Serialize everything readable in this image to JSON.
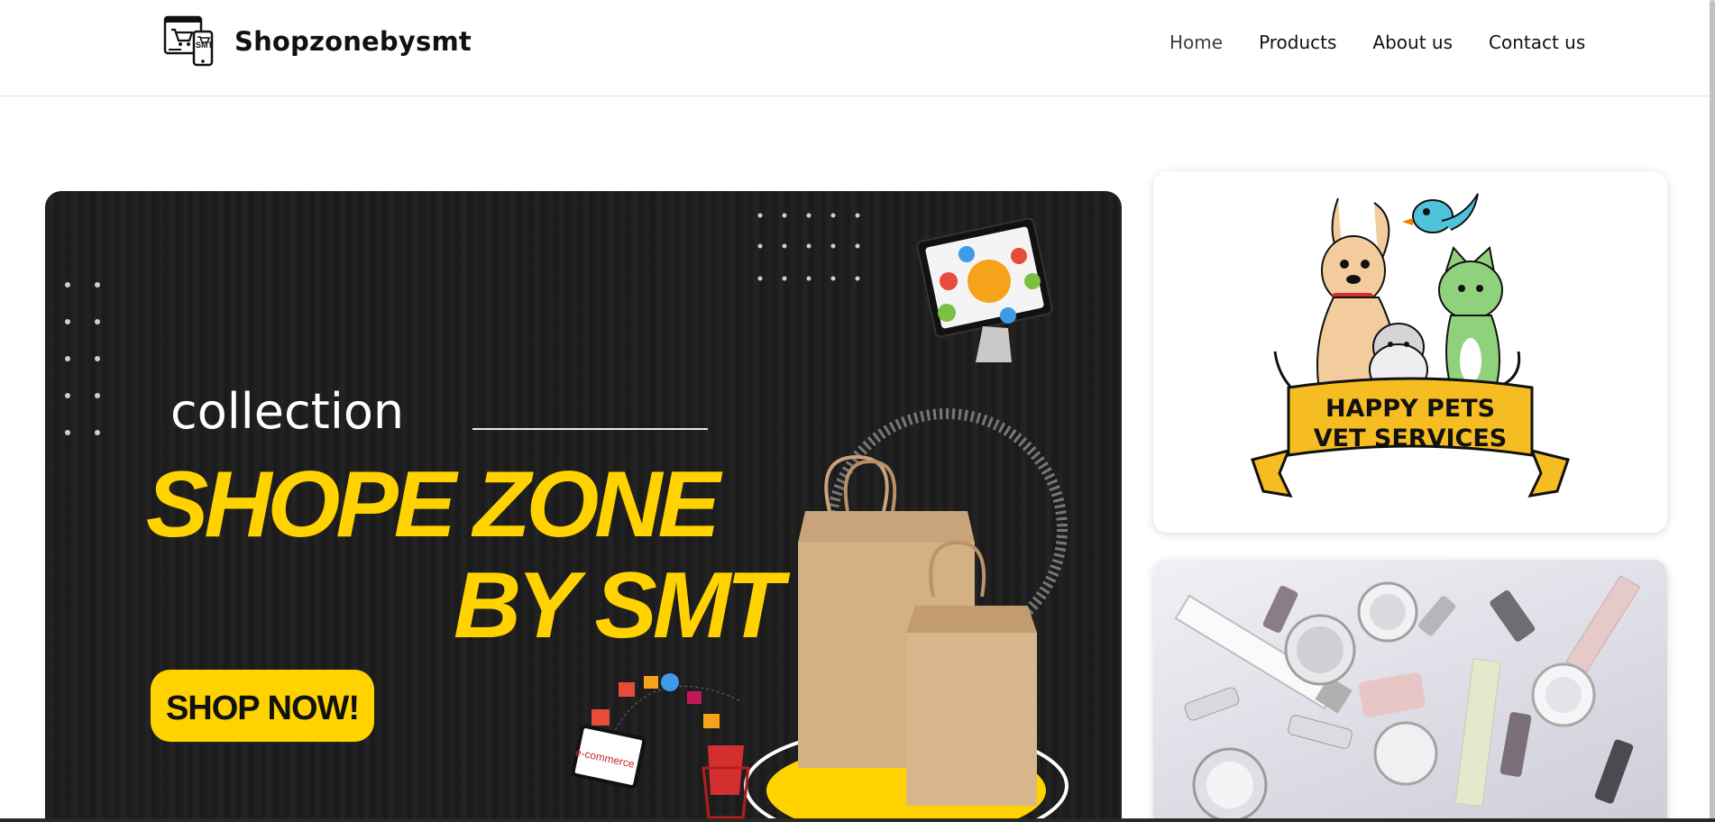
{
  "header": {
    "brand_name": "Shopzonebysmt",
    "logo_icon": "shop-device-icon",
    "nav": [
      {
        "label": "Home",
        "active": true
      },
      {
        "label": "Products",
        "active": false
      },
      {
        "label": "About us",
        "active": false
      },
      {
        "label": "Contact us",
        "active": false
      }
    ]
  },
  "hero": {
    "kicker": "collection",
    "title_line1": "SHOPE ZONE",
    "title_line2": "BY SMT",
    "cta_label": "SHOP NOW!",
    "badge_text": "e-commerce",
    "accent_color": "#ffd200"
  },
  "side_cards": {
    "pets": {
      "line1": "HAPPY PETS",
      "line2": "VET SERVICES",
      "banner_color": "#f6bd22"
    },
    "cosmetics": {
      "image_icon": "cosmetics-products-icon"
    }
  }
}
